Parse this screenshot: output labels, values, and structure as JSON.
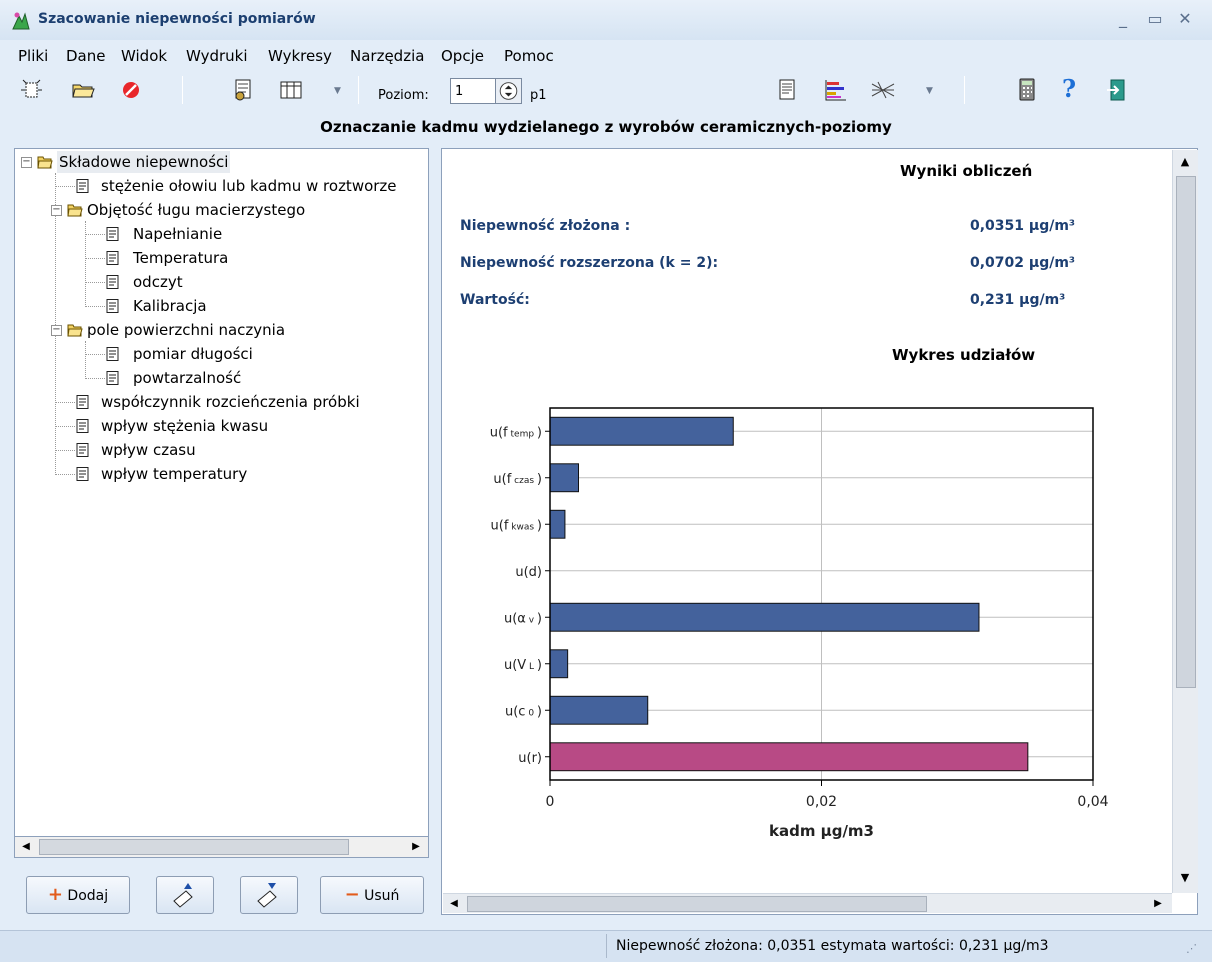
{
  "window": {
    "title": "Szacowanie niepewności pomiarów"
  },
  "menu": [
    "Pliki",
    "Dane",
    "Widok",
    "Wydruki",
    "Wykresy",
    "Narzędzia",
    "Opcje",
    "Pomoc"
  ],
  "toolbar": {
    "level_label": "Poziom:",
    "level_value": "1",
    "level_name": "p1"
  },
  "heading": "Oznaczanie kadmu wydzielanego z wyrobów ceramicznych-poziomy",
  "tree": {
    "root": "Składowe niepewności",
    "items": [
      "stężenie ołowiu lub kadmu w roztworze",
      "Objętość ługu macierzystego",
      "Napełnianie",
      "Temperatura",
      "odczyt",
      "Kalibracja",
      "pole powierzchni naczynia",
      "pomiar długości",
      "powtarzalność",
      "współczynnik rozcieńczenia próbki",
      "wpływ stężenia kwasu",
      "wpływ czasu",
      "wpływ temperatury"
    ]
  },
  "buttons": {
    "add": "Dodaj",
    "remove": "Usuń"
  },
  "results": {
    "title": "Wyniki obliczeń",
    "rows": [
      {
        "label": "Niepewność złożona :",
        "value": "0,0351 µg/m³"
      },
      {
        "label": "Niepewność rozszerzona  (k = 2):",
        "value": "0,0702 µg/m³"
      },
      {
        "label": "Wartość:",
        "value": "0,231 µg/m³"
      }
    ]
  },
  "chart_title": "Wykres udziałów",
  "chart_data": {
    "type": "bar",
    "orientation": "horizontal",
    "categories": [
      {
        "base": "u(f",
        "sub": "temp",
        "close": ")"
      },
      {
        "base": "u(f",
        "sub": "czas",
        "close": ")"
      },
      {
        "base": "u(f",
        "sub": "kwas",
        "close": ")"
      },
      {
        "base": "u(d)",
        "sub": "",
        "close": ""
      },
      {
        "base": "u(α",
        "sub": "v",
        "close": ")"
      },
      {
        "base": "u(V",
        "sub": "L",
        "close": ")"
      },
      {
        "base": "u(c",
        "sub": "0",
        "close": ")"
      },
      {
        "base": "u(r)",
        "sub": "",
        "close": ""
      }
    ],
    "values": [
      0.0135,
      0.0021,
      0.0011,
      0,
      0.0316,
      0.0013,
      0.0072,
      0.0352
    ],
    "bar_colors": [
      "#44629c",
      "#44629c",
      "#44629c",
      "#44629c",
      "#44629c",
      "#44629c",
      "#44629c",
      "#b84a85"
    ],
    "xlim": [
      0,
      0.04
    ],
    "ticks": [
      "0",
      "0,02",
      "0,04"
    ],
    "tick_values": [
      0,
      0.02,
      0.04
    ],
    "xlabel": "kadm  µg/m3",
    "grid": true
  },
  "status": "Niepewność złożona: 0,0351   estymata wartości: 0,231 µg/m3"
}
